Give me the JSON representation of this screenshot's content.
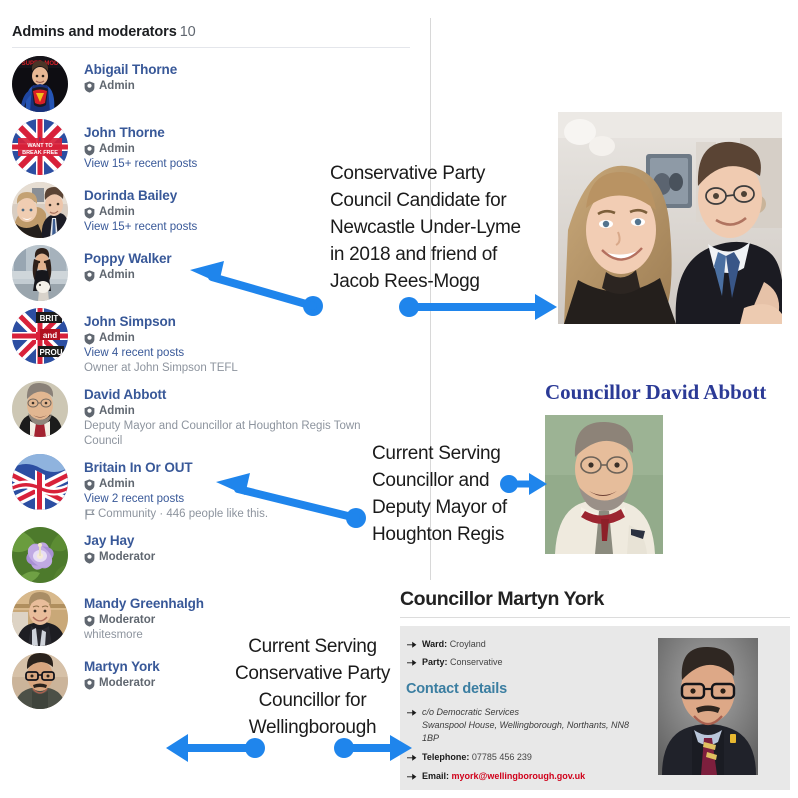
{
  "list": {
    "header_title": "Admins and moderators",
    "header_count": "10",
    "members": [
      {
        "name": "Abigail Thorne",
        "role": "Admin",
        "link": "",
        "sub": "",
        "flag": "",
        "avatar": "avatar-abigail-thorne"
      },
      {
        "name": "John Thorne",
        "role": "Admin",
        "link": "View 15+ recent posts",
        "sub": "",
        "flag": "",
        "avatar": "avatar-john-thorne"
      },
      {
        "name": "Dorinda Bailey",
        "role": "Admin",
        "link": "View 15+ recent posts",
        "sub": "",
        "flag": "",
        "avatar": "avatar-dorinda-bailey"
      },
      {
        "name": "Poppy Walker",
        "role": "Admin",
        "link": "",
        "sub": "",
        "flag": "",
        "avatar": "avatar-poppy-walker"
      },
      {
        "name": "John Simpson",
        "role": "Admin",
        "link": "View 4 recent posts",
        "sub": "Owner at John Simpson TEFL",
        "flag": "",
        "avatar": "avatar-john-simpson"
      },
      {
        "name": "David Abbott",
        "role": "Admin",
        "link": "",
        "sub": "Deputy Mayor and Councillor at Houghton Regis Town Council",
        "flag": "",
        "avatar": "avatar-david-abbott"
      },
      {
        "name": "Britain In Or OUT",
        "role": "Admin",
        "link": "View 2 recent posts",
        "sub": "",
        "flag": "Community · 446 people like this.",
        "avatar": "avatar-britain-in-or-out"
      },
      {
        "name": "Jay Hay",
        "role": "Moderator",
        "link": "",
        "sub": "",
        "flag": "",
        "avatar": "avatar-jay-hay"
      },
      {
        "name": "Mandy Greenhalgh",
        "role": "Moderator",
        "link": "",
        "sub": "whitesmore",
        "flag": "",
        "avatar": "avatar-mandy-greenhalgh"
      },
      {
        "name": "Martyn York",
        "role": "Moderator",
        "link": "",
        "sub": "",
        "flag": "",
        "avatar": "avatar-martyn-york"
      }
    ]
  },
  "annotations": {
    "reesmogg": "Conservative Party Council Candidate for Newcastle Under-Lyme in 2018 and friend of Jacob Rees-Mogg",
    "abbott": "Current Serving Councillor and Deputy Mayor of Houghton Regis",
    "york": "Current Serving Conservative Party Councillor for Wellingborough",
    "arrow_color": "#1f85ec"
  },
  "abbott_panel": {
    "title": "Councillor David Abbott",
    "title_color": "#2b3a96",
    "photo": "photo-david-abbott"
  },
  "reesmogg_panel": {
    "photo": "photo-dorinda-bailey-with-jacob-rees-mogg"
  },
  "york_card": {
    "title": "Councillor Martyn York",
    "ward_label": "Ward:",
    "ward_value": "Croyland",
    "party_label": "Party:",
    "party_value": "Conservative",
    "contact_heading": "Contact details",
    "contact_heading_color": "#3b7ea1",
    "address_line1": "c/o Democratic Services",
    "address_line2": "Swanspool House, Wellingborough, Northants, NN8",
    "address_line3": "1BP",
    "telephone_label": "Telephone:",
    "telephone_value": "07785 456 239",
    "email_label": "Email:",
    "email_value": "myork@wellingborough.gov.uk",
    "email_color": "#d0021b",
    "photo": "photo-martyn-york"
  }
}
